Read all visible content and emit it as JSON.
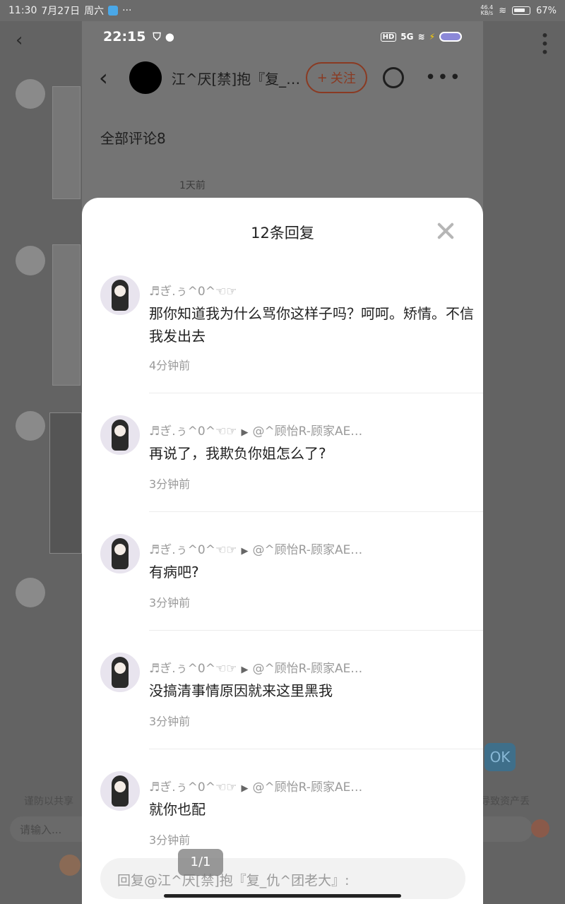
{
  "system_bar": {
    "time": "11:30",
    "date": "7月27日",
    "weekday": "周六",
    "dots": "···",
    "net_speed": "46.4",
    "net_unit": "KB/s",
    "battery": "67%"
  },
  "outer": {
    "notice_left": "谨防以共享",
    "notice_right": "导致资产丢",
    "input_placeholder": "请输入...",
    "ok_label": "OK"
  },
  "phone": {
    "status_time": "22:15",
    "hd": "HD",
    "net": "5G",
    "header_title": "江^厌[禁]抱『复_…",
    "follow_label": "关注",
    "follow_icon": "plus-icon",
    "all_comments": "全部评论8",
    "comment_time": "1天前"
  },
  "sheet": {
    "title": "12条回复",
    "replies": [
      {
        "user": "♬ぎ.ぅ^0^☜☞",
        "reply_to": "",
        "text": "那你知道我为什么骂你这样子吗？呵呵。矫情。不信我发出去",
        "time": "4分钟前"
      },
      {
        "user": "♬ぎ.ぅ^0^☜☞",
        "reply_to": "@^顾怡R-顾家AE…",
        "text": "再说了，我欺负你姐怎么了?",
        "time": "3分钟前"
      },
      {
        "user": "♬ぎ.ぅ^0^☜☞",
        "reply_to": "@^顾怡R-顾家AE…",
        "text": "有病吧?",
        "time": "3分钟前"
      },
      {
        "user": "♬ぎ.ぅ^0^☜☞",
        "reply_to": "@^顾怡R-顾家AE…",
        "text": "没搞清事情原因就来这里黑我",
        "time": "3分钟前"
      },
      {
        "user": "♬ぎ.ぅ^0^☜☞",
        "reply_to": "@^顾怡R-顾家AE…",
        "text": "就你也配",
        "time": "3分钟前"
      }
    ],
    "input_placeholder": "回复@江^厌[禁]抱『复_仇^团老大』:"
  },
  "page_badge": "1/1"
}
